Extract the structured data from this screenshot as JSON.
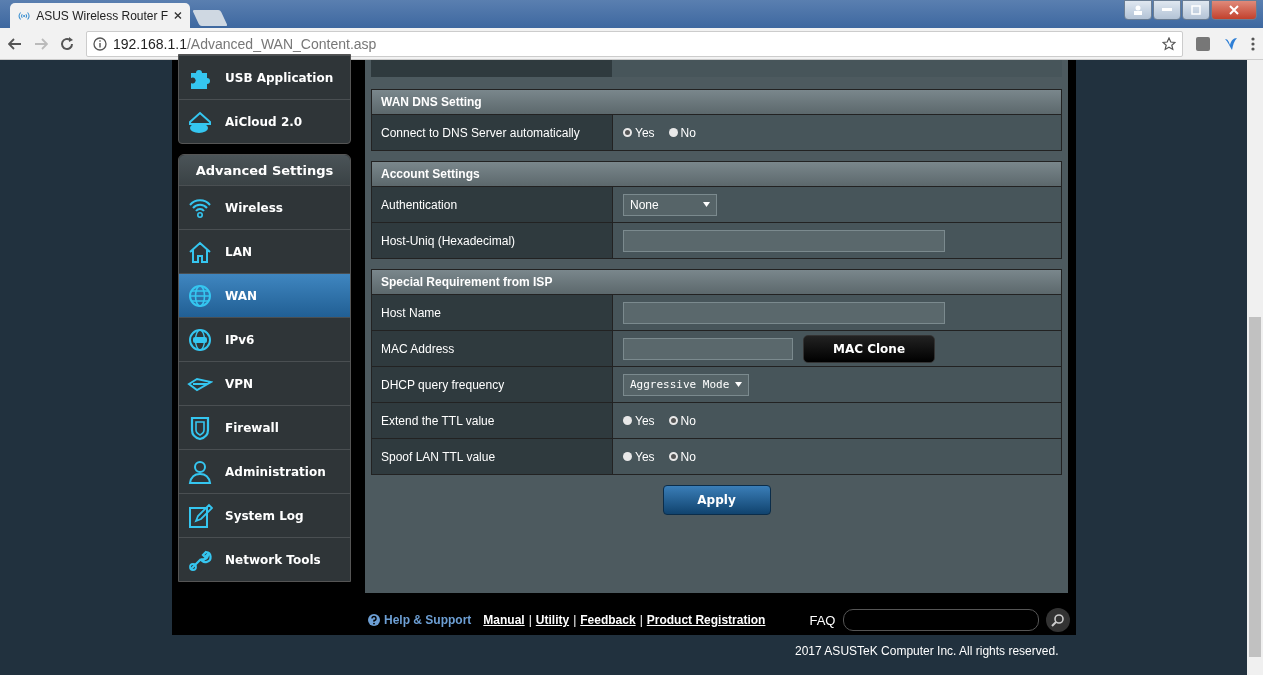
{
  "browser": {
    "tab_title": "ASUS Wireless Router F",
    "url_host": "192.168.1.1",
    "url_path": "/Advanced_WAN_Content.asp"
  },
  "sidebar": {
    "top_items": [
      {
        "label": "USB Application"
      },
      {
        "label": "AiCloud 2.0"
      }
    ],
    "section_title": "Advanced Settings",
    "items": [
      {
        "label": "Wireless",
        "selected": false
      },
      {
        "label": "LAN",
        "selected": false
      },
      {
        "label": "WAN",
        "selected": true
      },
      {
        "label": "IPv6",
        "selected": false
      },
      {
        "label": "VPN",
        "selected": false
      },
      {
        "label": "Firewall",
        "selected": false
      },
      {
        "label": "Administration",
        "selected": false
      },
      {
        "label": "System Log",
        "selected": false
      },
      {
        "label": "Network Tools",
        "selected": false
      }
    ]
  },
  "sections": [
    {
      "title": "WAN DNS Setting",
      "rows": [
        {
          "label": "Connect to DNS Server automatically",
          "kind": "radio",
          "options": [
            {
              "label": "Yes",
              "selected": true
            },
            {
              "label": "No",
              "selected": false
            }
          ]
        }
      ]
    },
    {
      "title": "Account Settings",
      "rows": [
        {
          "label": "Authentication",
          "kind": "select",
          "value": "None"
        },
        {
          "label": "Host-Uniq (Hexadecimal)",
          "kind": "text"
        }
      ]
    },
    {
      "title": "Special Requirement from ISP",
      "rows": [
        {
          "label": "Host Name",
          "kind": "text"
        },
        {
          "label": "MAC Address",
          "kind": "text_button",
          "button": "MAC Clone"
        },
        {
          "label": "DHCP query frequency",
          "kind": "select_mono",
          "value": "Aggressive Mode"
        },
        {
          "label": "Extend the TTL value",
          "kind": "radio",
          "options": [
            {
              "label": "Yes",
              "selected": false
            },
            {
              "label": "No",
              "selected": true
            }
          ]
        },
        {
          "label": "Spoof LAN TTL value",
          "kind": "radio",
          "options": [
            {
              "label": "Yes",
              "selected": false
            },
            {
              "label": "No",
              "selected": true
            }
          ]
        }
      ]
    }
  ],
  "apply_button": "Apply",
  "footer": {
    "help": "Help & Support",
    "links": [
      "Manual",
      "Utility",
      "Feedback",
      "Product Registration"
    ],
    "separator": "|",
    "faq_label": "FAQ"
  },
  "copyright": "2017 ASUSTeK Computer Inc. All rights reserved."
}
